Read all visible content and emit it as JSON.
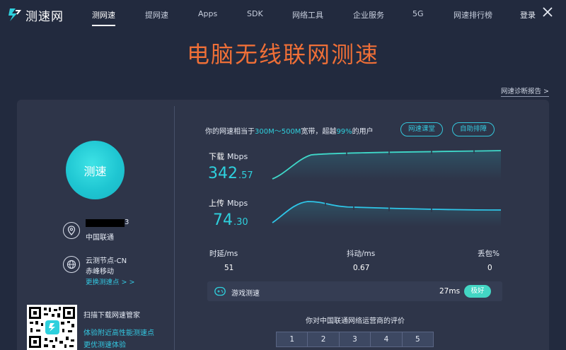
{
  "brand": {
    "name": "测速网"
  },
  "nav": {
    "items": [
      "测网速",
      "提网速",
      "Apps",
      "SDK",
      "网络工具",
      "企业服务",
      "5G",
      "网速排行榜"
    ],
    "login": "登录"
  },
  "title": "电脑无线联网测速",
  "report_link": "网速诊断报告 >",
  "left": {
    "test_button": "测速",
    "isp_suffix": "3",
    "isp": "中国联通",
    "node_name": "云测节点-CN",
    "node_isp": "赤峰移动",
    "change_node": "更换测速点 > >",
    "qr_title": "扫描下载网速管家",
    "qr_line1": "体验附近高性能测速点",
    "qr_line2": "更优测速体验"
  },
  "rank": {
    "prefix": "你的网速相当于",
    "band": "300M～500M",
    "mid": "宽带，超越",
    "percent": "99%",
    "suffix": "的用户",
    "btn_course": "网速课堂",
    "btn_rank": "自助排障"
  },
  "download": {
    "label": "下载",
    "unit": "Mbps",
    "int": "342",
    "dec": ".57"
  },
  "upload": {
    "label": "上传",
    "unit": "Mbps",
    "int": "74",
    "dec": ".30"
  },
  "stats": {
    "latency_label": "时延/ms",
    "latency": "51",
    "jitter_label": "抖动/ms",
    "jitter": "0.67",
    "loss_label": "丢包%",
    "loss": "0"
  },
  "game": {
    "label": "游戏测速",
    "ms": "27ms",
    "badge": "极好"
  },
  "rating": {
    "title": "你对中国联通网络运营商的评价",
    "options": [
      "1",
      "2",
      "3",
      "4",
      "5"
    ]
  },
  "colors": {
    "accent": "#2ed0dd",
    "title": "#ef6f37",
    "bg": "#222a3e",
    "panel": "#2e3549"
  }
}
